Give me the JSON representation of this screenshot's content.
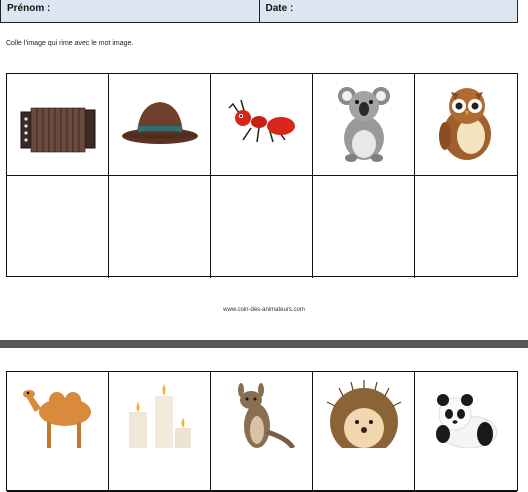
{
  "header": {
    "name_label": "Prénom :",
    "date_label": "Date :"
  },
  "instruction": "Colle l'image qui rime avec le mot image.",
  "top_row_icons": [
    "accordion-icon",
    "hat-icon",
    "ant-icon",
    "koala-icon",
    "owl-icon"
  ],
  "bottom_row_icons": [
    "camel-icon",
    "candles-icon",
    "kangaroo-icon",
    "hedgehog-icon",
    "panda-icon"
  ],
  "footer": "www.coin-des-animateurs.com"
}
